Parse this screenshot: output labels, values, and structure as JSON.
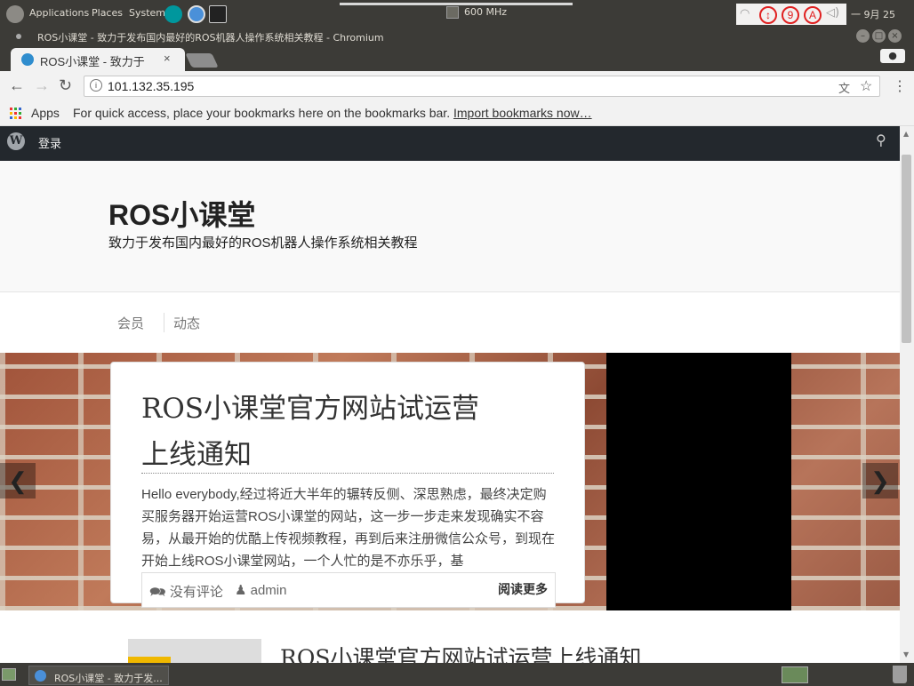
{
  "system_panel": {
    "menus": [
      "Applications",
      "Places",
      "System"
    ],
    "cpu_freq": "600 MHz",
    "tray_badges": [
      "↕",
      "9",
      "A"
    ],
    "clock": "一 9月 25"
  },
  "window": {
    "title": "ROS小课堂 - 致力于发布国内最好的ROS机器人操作系统相关教程 - Chromium"
  },
  "tab": {
    "label": "ROS小课堂 - 致力于",
    "close": "×"
  },
  "toolbar": {
    "url": "101.132.35.195"
  },
  "bookmarks": {
    "apps_label": "Apps",
    "hint_text": "For quick access, place your bookmarks here on the bookmarks bar.",
    "import_link": "Import bookmarks now…"
  },
  "site": {
    "admin_bar": {
      "login": "登录"
    },
    "title": "ROS小课堂",
    "tagline": "致力于发布国内最好的ROS机器人操作系统相关教程",
    "nav": [
      "会员",
      "动态"
    ]
  },
  "slider": {
    "post_title": "ROS小课堂官方网站试运营上线通知",
    "excerpt": " Hello everybody,经过将近大半年的辗转反侧、深思熟虑，最终决定购买服务器开始运营ROS小课堂的网站，这一步一步走来发现确实不容易，从最开始的优酷上传视频教程，再到后来注册微信公众号，到现在开始上线ROS小课堂网站，一个人忙的是不亦乐乎，基",
    "comments": "没有评论",
    "author": "admin",
    "read_more": "阅读更多",
    "prev": "❮",
    "next": "❯"
  },
  "post_list": {
    "title": "ROS小课堂官方网站试运营上线通知"
  },
  "taskbar": {
    "item_label": "ROS小课堂 - 致力于发..."
  },
  "colors": {
    "wp_admin_bar": "#23282d",
    "ubuntu_panel": "#3c3b37",
    "tray_badge_red": "#e02020"
  }
}
